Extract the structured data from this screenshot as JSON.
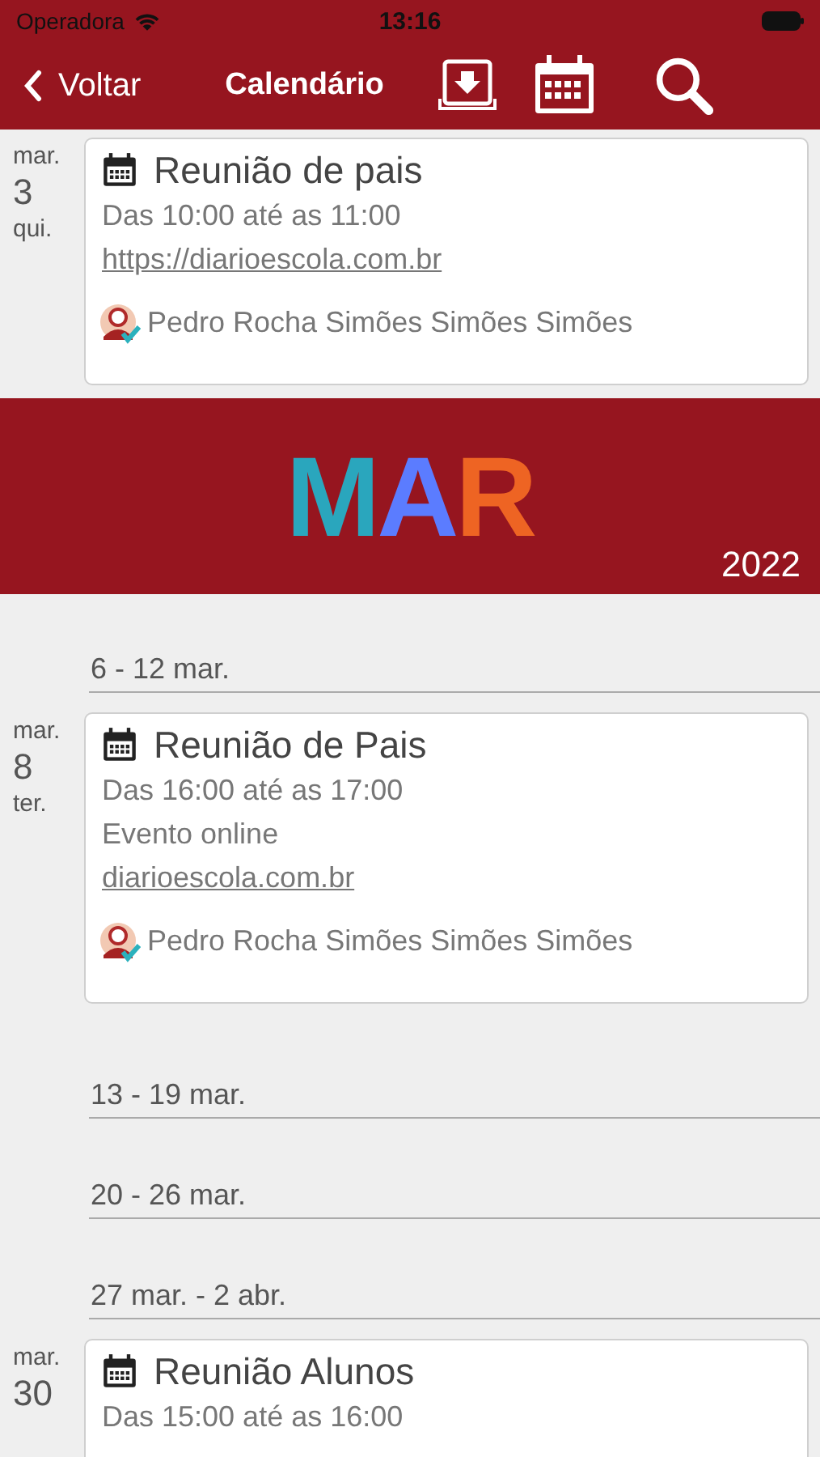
{
  "status_bar": {
    "carrier": "Operadora",
    "time": "13:16"
  },
  "nav": {
    "back": "Voltar",
    "title": "Calendário"
  },
  "items": [
    {
      "kind": "event",
      "day": {
        "month": "mar.",
        "number": "3",
        "weekday": "qui."
      },
      "title": "Reunião de pais",
      "time": "Das 10:00 até as 11:00",
      "link": "https://diarioescola.com.br",
      "attendee": "Pedro Rocha Simões Simões Simões"
    },
    {
      "kind": "month",
      "name": "MAR",
      "year": "2022"
    },
    {
      "kind": "week",
      "label": "6 - 12 mar."
    },
    {
      "kind": "event",
      "day": {
        "month": "mar.",
        "number": "8",
        "weekday": "ter."
      },
      "title": "Reunião de Pais",
      "time": "Das 16:00 até as 17:00",
      "location": "Evento online",
      "link": "diarioescola.com.br",
      "attendee": "Pedro Rocha Simões Simões Simões"
    },
    {
      "kind": "week",
      "label": "13 - 19 mar."
    },
    {
      "kind": "week",
      "label": "20 - 26 mar."
    },
    {
      "kind": "week",
      "label": "27 mar. - 2 abr."
    },
    {
      "kind": "event",
      "day": {
        "month": "mar.",
        "number": "30"
      },
      "title": "Reunião Alunos",
      "time": "Das 15:00 até as 16:00"
    }
  ]
}
